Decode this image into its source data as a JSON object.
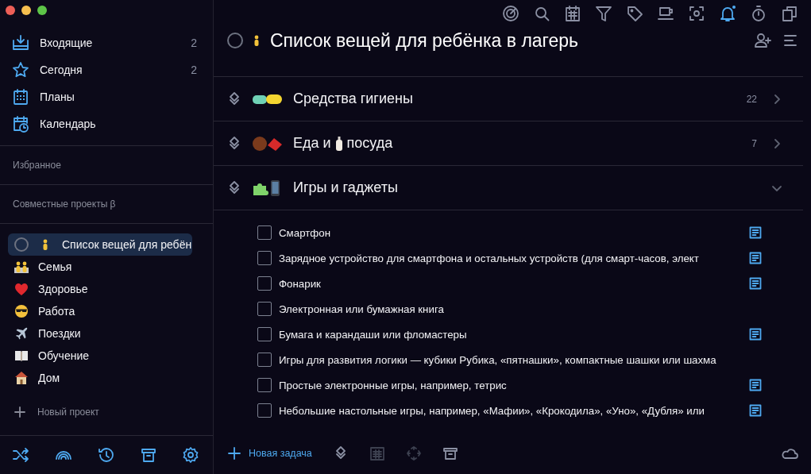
{
  "toolbar": {
    "notifications_unread": true
  },
  "sidebar": {
    "nav": [
      {
        "label": "Входящие",
        "count": "2"
      },
      {
        "label": "Сегодня",
        "count": "2"
      },
      {
        "label": "Планы"
      },
      {
        "label": "Календарь"
      }
    ],
    "favorites_label": "Избранное",
    "shared_label": "Совместные проекты β",
    "projects": [
      {
        "label": "Список вещей для ребён",
        "selected": true
      },
      {
        "label": "Семья",
        "selected": false
      },
      {
        "label": "Здоровье",
        "selected": false
      },
      {
        "label": "Работа",
        "selected": false
      },
      {
        "label": "Поездки",
        "selected": false
      },
      {
        "label": "Обучение",
        "selected": false
      },
      {
        "label": "Дом",
        "selected": false
      }
    ],
    "new_project": "Новый проект"
  },
  "header": {
    "title": "Список вещей для ребёнка в лагерь"
  },
  "sections": [
    {
      "title": [
        "Средства гигиены"
      ],
      "count": "22",
      "expanded": false
    },
    {
      "title": [
        "Еда и",
        "посуда"
      ],
      "count": "7",
      "expanded": false
    },
    {
      "title": [
        "Игры и гаджеты"
      ],
      "expanded": true
    }
  ],
  "tasks": [
    {
      "label": "Смартфон",
      "checked": false,
      "has_note": true
    },
    {
      "label": "Зарядное устройство для смартфона и остальных устройств (для смарт-часов, элект",
      "checked": false,
      "has_note": true
    },
    {
      "label": "Фонарик",
      "checked": false,
      "has_note": true
    },
    {
      "label": "Электронная или бумажная книга",
      "checked": false,
      "has_note": false
    },
    {
      "label": "Бумага и карандаши или фломастеры",
      "checked": false,
      "has_note": true
    },
    {
      "label": "Игры для развития логики — кубики Рубика, «пятнашки», компактные шашки или шахма",
      "checked": false,
      "has_note": false
    },
    {
      "label": "Простые электронные игры, например, тетрис",
      "checked": false,
      "has_note": true
    },
    {
      "label": "Небольшие настольные игры, например, «Мафии», «Крокодила», «Уно», «Дубля» или",
      "checked": false,
      "has_note": true
    }
  ],
  "bottom": {
    "new_task": "Новая задача"
  }
}
